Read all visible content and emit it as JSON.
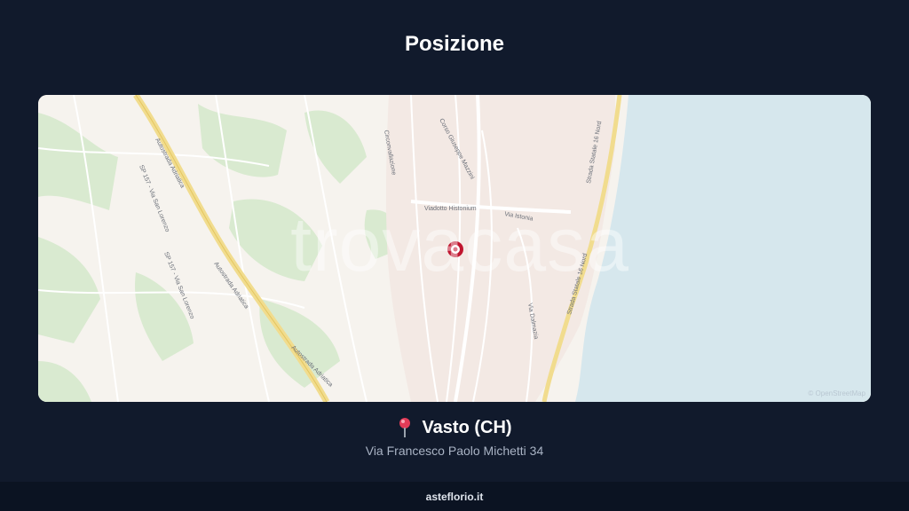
{
  "header": {
    "title": "Posizione"
  },
  "map": {
    "watermark": "trovacasa",
    "attribution": "© OpenStreetMap",
    "street_labels": {
      "corso_mazzini": "Corso Giuseppe Mazzini",
      "viadotto": "Viadotto Histonium",
      "via_istonia": "Via Istonia",
      "circonvallazione": "Circonvallazione",
      "autostrada_1": "Autostrada Adriatica",
      "autostrada_2": "Autostrada Adriatica",
      "autostrada_3": "Autostrada Adriatica",
      "sp157_1": "SP 157 - Via San Lorenzo",
      "sp157_2": "SP 157 - Via San Lorenzo",
      "statale_1": "Strada Statale 16 Nord",
      "statale_2": "Strada Statale 16 Nord",
      "via_dalmazia": "Via Dalmazia"
    },
    "marker_icon": "location-marker-icon"
  },
  "location": {
    "pin_icon": "pin-icon",
    "city": "Vasto (CH)",
    "address": "Via Francesco Paolo Michetti 34"
  },
  "footer": {
    "site": "asteflorio.it"
  },
  "colors": {
    "background": "#111a2c",
    "sea": "#d6e7ed",
    "land": "#f6f3ee",
    "highway": "#f1dc8e",
    "marker": "#c0152f"
  }
}
